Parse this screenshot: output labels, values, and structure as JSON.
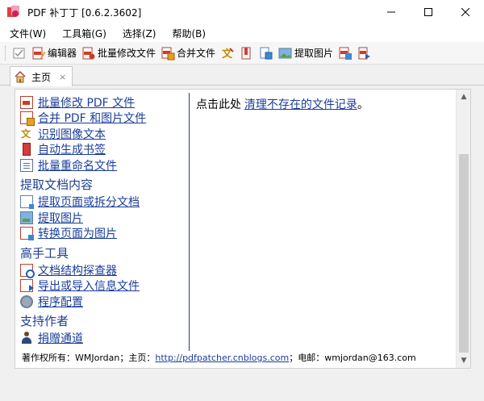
{
  "window": {
    "title": "PDF 补丁丁 [0.6.2.3602]",
    "buttons": {
      "minimize": "—",
      "maximize": "☐",
      "close": "✕"
    }
  },
  "menu": [
    {
      "label": "文件(W)"
    },
    {
      "label": "工具箱(G)"
    },
    {
      "label": "选择(Z)"
    },
    {
      "label": "帮助(B)"
    }
  ],
  "toolbar": {
    "editor": "编辑器",
    "batch_modify": "批量修改文件",
    "merge": "合并文件",
    "extract_images": "提取图片"
  },
  "tab": {
    "label": "主页",
    "close": "×"
  },
  "left_pane": {
    "items_top": [
      {
        "label": "批量修改 PDF 文件",
        "icon": "pdf-batch-icon"
      },
      {
        "label": "合并 PDF 和图片文件",
        "icon": "merge-icon"
      },
      {
        "label": "识别图像文本",
        "icon": "ocr-icon"
      },
      {
        "label": "自动生成书签",
        "icon": "bookmark-icon"
      },
      {
        "label": "批量重命名文件",
        "icon": "rename-icon"
      }
    ],
    "section_extract": "提取文档内容",
    "items_extract": [
      {
        "label": "提取页面或拆分文档",
        "icon": "split-icon"
      },
      {
        "label": "提取图片",
        "icon": "image-icon"
      },
      {
        "label": "转换页面为图片",
        "icon": "convert-icon"
      }
    ],
    "section_advanced": "高手工具",
    "items_advanced": [
      {
        "label": "文档结构探查器",
        "icon": "structure-icon"
      },
      {
        "label": "导出或导入信息文件",
        "icon": "export-icon"
      },
      {
        "label": "程序配置",
        "icon": "settings-icon"
      }
    ],
    "section_support": "支持作者",
    "items_support": [
      {
        "label": "捐赠通道",
        "icon": "person-icon"
      }
    ]
  },
  "right_pane": {
    "prefix": "点击此处",
    "link": "清理不存在的文件记录",
    "suffix": "。"
  },
  "footer": {
    "copyright": "著作权所有：WMJordan；主页：",
    "homepage": "http://pdfpatcher.cnblogs.com",
    "email_label": "；电邮：",
    "email": "wmjordan@163.com"
  },
  "scrollbar": {
    "up": "▲",
    "down": "▼"
  }
}
